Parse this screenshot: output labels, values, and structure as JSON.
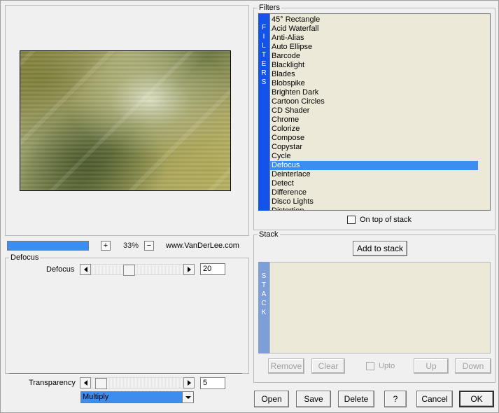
{
  "preview": {
    "zoom": "33%",
    "progress_percent": 100,
    "zoom_in_label": "+",
    "zoom_out_label": "−",
    "site": "www.VanDerLee.com"
  },
  "defocus_group": {
    "title": "Defocus",
    "slider_label": "Defocus",
    "value": "20"
  },
  "blend": {
    "transparency_label": "Transparency",
    "transparency_value": "5",
    "mode": "Multiply"
  },
  "filters": {
    "title": "Filters",
    "banner": [
      "F",
      "I",
      "L",
      "T",
      "E",
      "R",
      "S"
    ],
    "items": [
      "45° Rectangle",
      "Acid Waterfall",
      "Anti-Alias",
      "Auto Ellipse",
      "Barcode",
      "Blacklight",
      "Blades",
      "Blobspike",
      "Brighten Dark",
      "Cartoon Circles",
      "CD Shader",
      "Chrome",
      "Colorize",
      "Compose",
      "Copystar",
      "Cycle",
      "Defocus",
      "Deinterlace",
      "Detect",
      "Difference",
      "Disco Lights",
      "Distortion"
    ],
    "selected_index": 16,
    "on_top_label": "On top of stack"
  },
  "stack": {
    "title": "Stack",
    "add_label": "Add to stack",
    "banner": [
      "S",
      "T",
      "A",
      "C",
      "K"
    ],
    "remove_label": "Remove",
    "clear_label": "Clear",
    "upto_label": "Upto",
    "up_label": "Up",
    "down_label": "Down"
  },
  "footer": {
    "open": "Open",
    "save": "Save",
    "delete": "Delete",
    "help": "?",
    "cancel": "Cancel",
    "ok": "OK"
  },
  "colors": {
    "accent": "#3c8df0",
    "filters_banner": "#1453ea",
    "stack_banner": "#7e9ed8",
    "list_bg": "#ece9d8"
  }
}
